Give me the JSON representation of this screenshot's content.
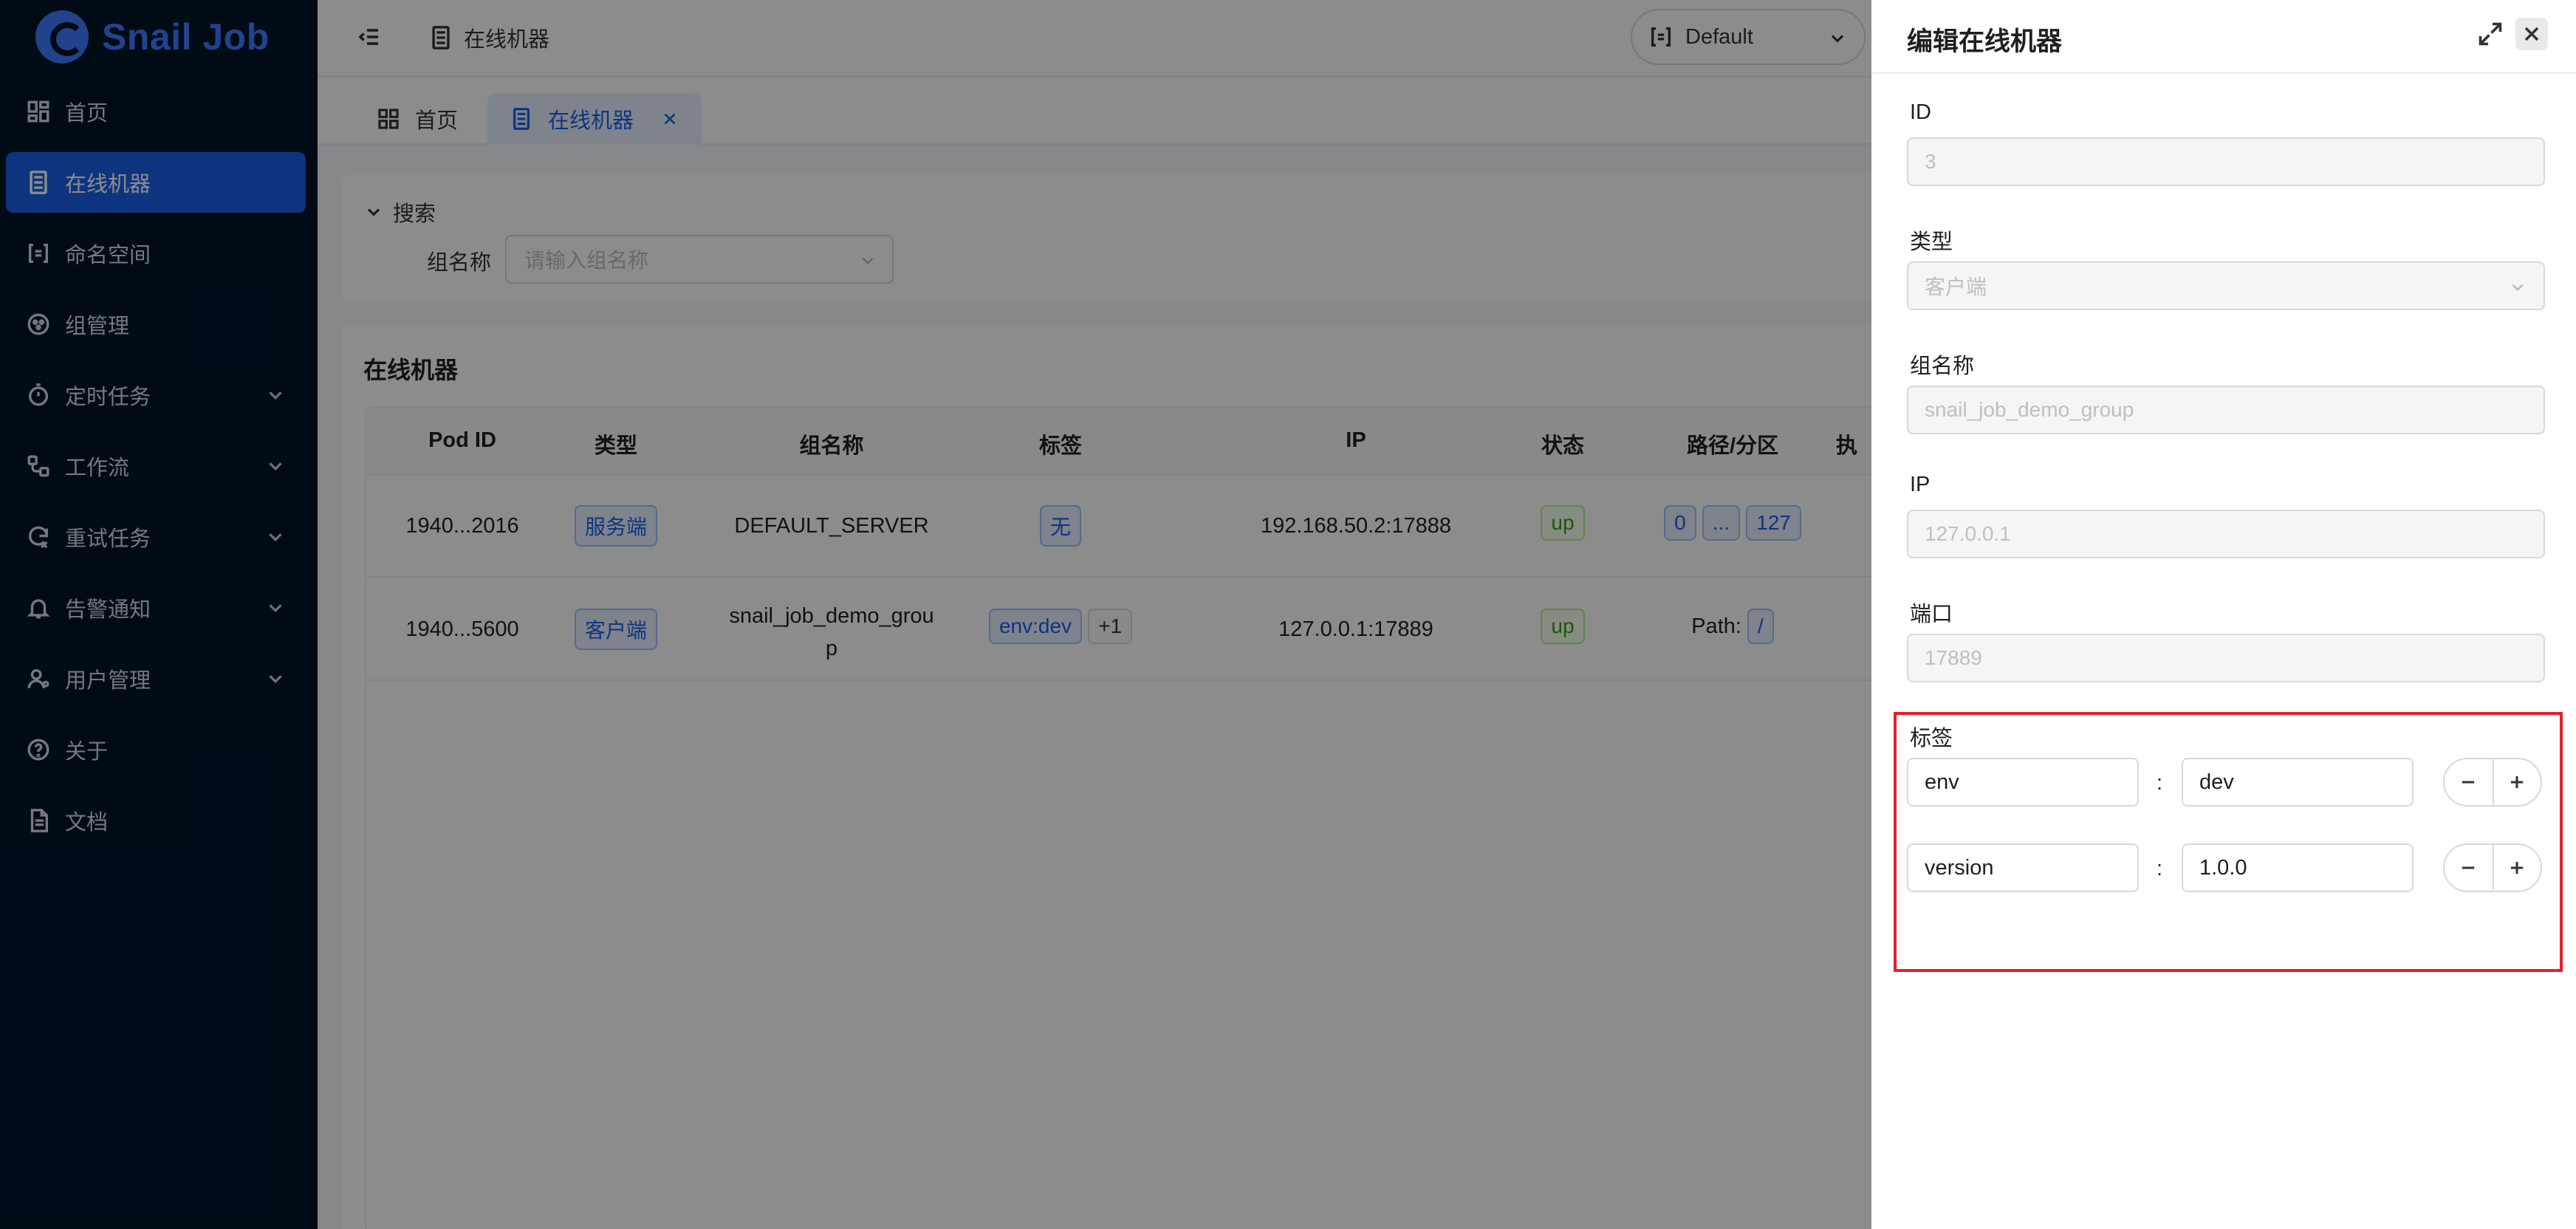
{
  "app": {
    "name": "Snail Job",
    "brand_color": "#3f7bff"
  },
  "sidebar": {
    "items": [
      {
        "label": "首页",
        "icon": "dashboard-icon"
      },
      {
        "label": "在线机器",
        "icon": "server-icon",
        "active": true
      },
      {
        "label": "命名空间",
        "icon": "namespace-icon"
      },
      {
        "label": "组管理",
        "icon": "group-icon"
      },
      {
        "label": "定时任务",
        "icon": "timer-icon",
        "expandable": true
      },
      {
        "label": "工作流",
        "icon": "workflow-icon",
        "expandable": true
      },
      {
        "label": "重试任务",
        "icon": "retry-icon",
        "expandable": true
      },
      {
        "label": "告警通知",
        "icon": "bell-icon",
        "expandable": true
      },
      {
        "label": "用户管理",
        "icon": "user-icon",
        "expandable": true
      },
      {
        "label": "关于",
        "icon": "help-icon"
      },
      {
        "label": "文档",
        "icon": "document-icon"
      }
    ]
  },
  "header": {
    "breadcrumb": "在线机器",
    "namespace": "Default"
  },
  "tabs": [
    {
      "label": "首页",
      "active": false
    },
    {
      "label": "在线机器",
      "active": true
    }
  ],
  "search": {
    "title": "搜索",
    "group_label": "组名称",
    "group_placeholder": "请输入组名称"
  },
  "table": {
    "title": "在线机器",
    "columns": [
      "Pod ID",
      "类型",
      "组名称",
      "标签",
      "IP",
      "状态",
      "路径/分区",
      "执"
    ],
    "rows": [
      {
        "pod_id": "1940...2016",
        "type": "服务端",
        "group": "DEFAULT_SERVER",
        "tag": "无",
        "tag_extra": "",
        "ip": "192.168.50.2:17888",
        "status": "up",
        "path_prefix": "",
        "path": [
          "0",
          "...",
          "127"
        ]
      },
      {
        "pod_id": "1940...5600",
        "type": "客户端",
        "group_line1": "snail_job_demo_grou",
        "group_line2": "p",
        "tag": "env:dev",
        "tag_extra": "+1",
        "ip": "127.0.0.1:17889",
        "status": "up",
        "path_prefix": "Path:",
        "path": [
          "/"
        ]
      }
    ]
  },
  "drawer": {
    "title": "编辑在线机器",
    "fields": [
      {
        "label": "ID",
        "value": "3"
      },
      {
        "label": "类型",
        "value": "客户端"
      },
      {
        "label": "组名称",
        "value": "snail_job_demo_group"
      },
      {
        "label": "IP",
        "value": "127.0.0.1"
      },
      {
        "label": "端口",
        "value": "17889"
      }
    ],
    "tags_label": "标签",
    "tags": [
      {
        "key": "env",
        "value": "dev"
      },
      {
        "key": "version",
        "value": "1.0.0"
      }
    ],
    "separator": ":",
    "highlight_color": "#e0202c"
  }
}
